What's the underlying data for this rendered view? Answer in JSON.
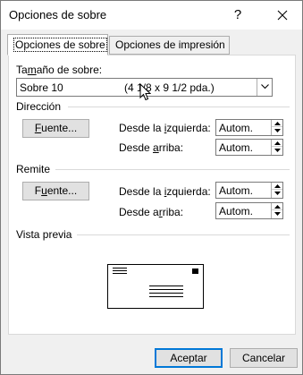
{
  "window": {
    "title": "Opciones de sobre",
    "help_label": "?"
  },
  "tabs": [
    {
      "label": "Opciones de sobre",
      "selected": true
    },
    {
      "label": "Opciones de impresión",
      "selected": false
    }
  ],
  "envelope_size": {
    "label_pre": "Ta",
    "label_underline": "m",
    "label_post": "año de sobre:",
    "value": "Sobre 10",
    "detail": "(4 1/8 x 9 1/2 pda.)"
  },
  "direccion": {
    "title": "Dirección",
    "font_button": {
      "underline": "F",
      "rest": "uente..."
    },
    "left_label": {
      "pre": "Desde la ",
      "underline": "i",
      "post": "zquierda:"
    },
    "left_value": "Autom.",
    "top_label": {
      "pre": "Desde ",
      "underline": "a",
      "post": "rriba:"
    },
    "top_value": "Autom."
  },
  "remite": {
    "title": "Remite",
    "font_button": {
      "pre": "F",
      "underline": "u",
      "rest": "ente..."
    },
    "left_label": {
      "pre": "Desde la ",
      "underline": "i",
      "post": "zquierda:"
    },
    "left_value": "Autom.",
    "top_label": {
      "pre": "Desde a",
      "underline": "r",
      "post": "riba:"
    },
    "top_value": "Autom."
  },
  "preview": {
    "title": "Vista previa"
  },
  "footer": {
    "ok_label": "Aceptar",
    "cancel_label": "Cancelar"
  }
}
